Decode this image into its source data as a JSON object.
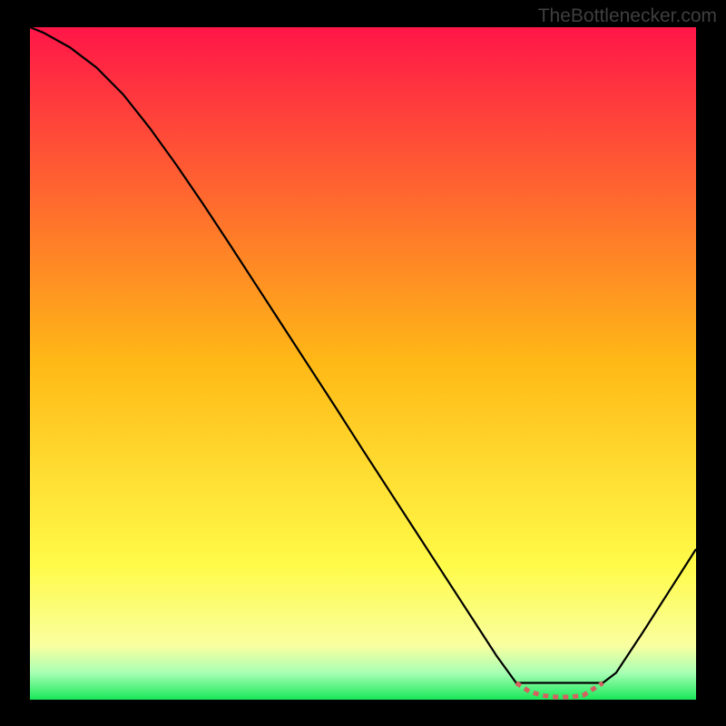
{
  "watermark": "TheBottlenecker.com",
  "chart_data": {
    "type": "line",
    "title": "",
    "xlabel": "",
    "ylabel": "",
    "xlim": [
      0,
      100
    ],
    "ylim": [
      0,
      100
    ],
    "x": [
      0,
      2,
      6,
      10,
      14,
      18,
      22,
      26,
      30,
      34,
      38,
      42,
      46,
      50,
      54,
      58,
      62,
      66,
      70,
      73,
      75,
      77,
      79,
      81,
      83,
      85,
      88,
      92,
      96,
      100
    ],
    "values": [
      100,
      99.2,
      97,
      94,
      90,
      85,
      79.5,
      73.7,
      67.7,
      61.6,
      55.5,
      49.4,
      43.3,
      37.1,
      31,
      24.9,
      18.8,
      12.7,
      6.6,
      2.5,
      1.2,
      0.6,
      0.4,
      0.4,
      0.6,
      1.2,
      4,
      10,
      16.2,
      22.4
    ],
    "series": [
      {
        "name": "solid-curve",
        "x": [
          0,
          2,
          6,
          10,
          14,
          18,
          22,
          26,
          30,
          34,
          38,
          42,
          46,
          50,
          54,
          58,
          62,
          66,
          70,
          73,
          86,
          88,
          92,
          96,
          100
        ],
        "y": [
          100,
          99.2,
          97,
          94,
          90,
          85,
          79.5,
          73.7,
          67.7,
          61.6,
          55.5,
          49.4,
          43.3,
          37.1,
          31,
          24.9,
          18.8,
          12.7,
          6.6,
          2.5,
          2.5,
          4,
          10,
          16.2,
          22.4
        ],
        "color": "#000000"
      },
      {
        "name": "dashed-segment",
        "x": [
          73,
          75,
          77,
          79,
          81,
          83,
          86
        ],
        "y": [
          2.5,
          1.2,
          0.6,
          0.4,
          0.4,
          0.6,
          2.5
        ],
        "color": "#d46060"
      }
    ],
    "gradient_stops": [
      {
        "pos": 0.0,
        "color": "#ff1648"
      },
      {
        "pos": 0.5,
        "color": "#ffb916"
      },
      {
        "pos": 0.8,
        "color": "#fffb48"
      },
      {
        "pos": 0.92,
        "color": "#f9ffa0"
      },
      {
        "pos": 0.96,
        "color": "#a8ffb5"
      },
      {
        "pos": 1.0,
        "color": "#18e858"
      }
    ]
  }
}
